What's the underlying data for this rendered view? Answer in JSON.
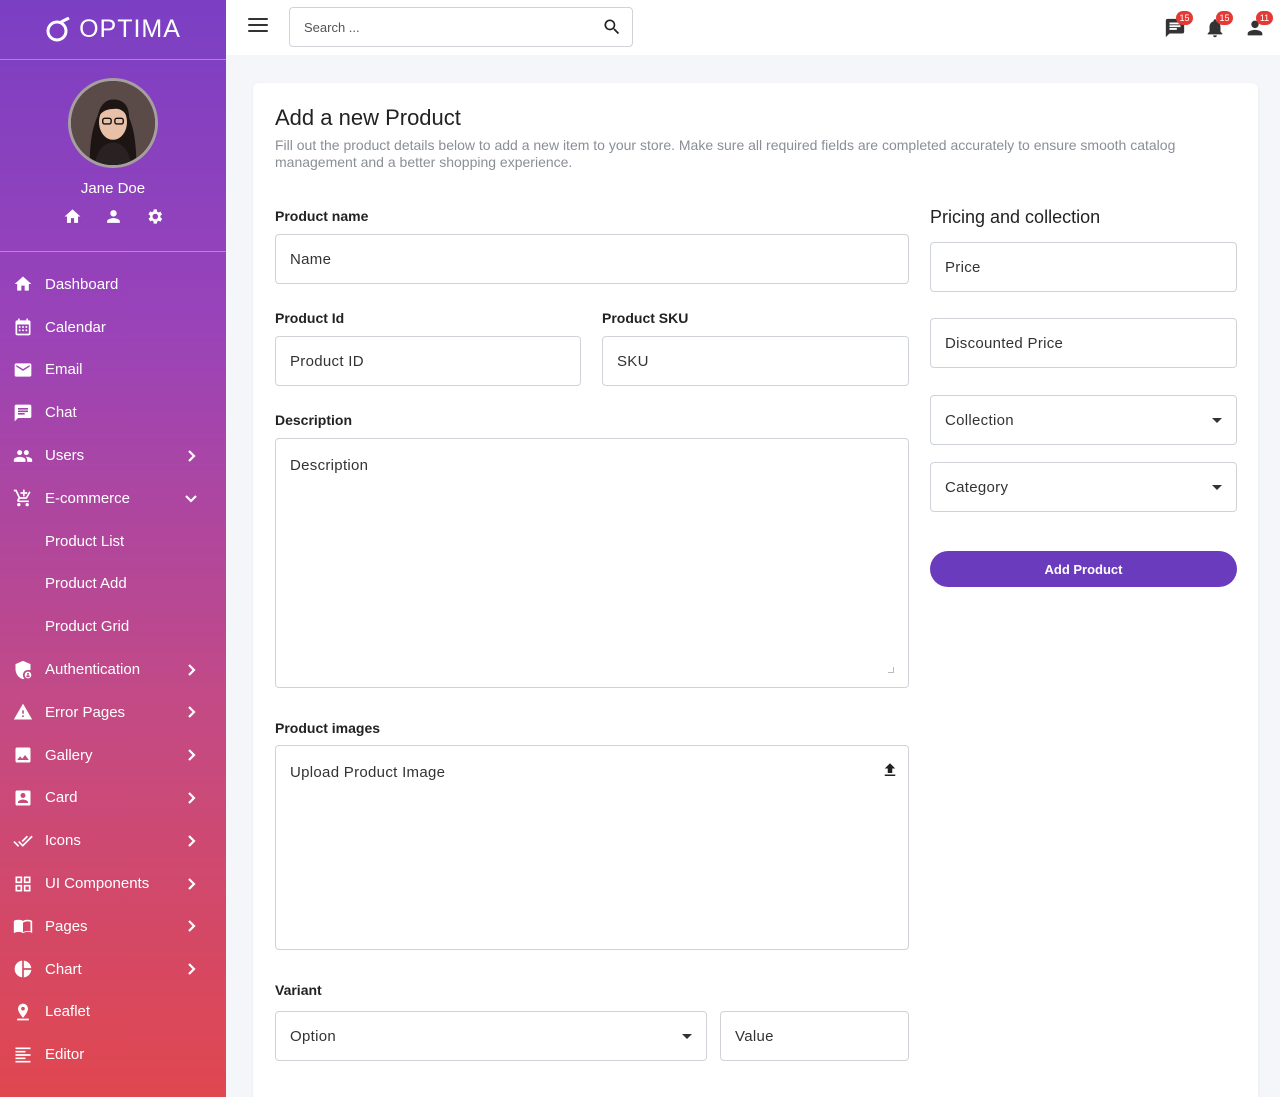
{
  "brand": {
    "name": "OPTIMA"
  },
  "user": {
    "name": "Jane Doe"
  },
  "sidebar": {
    "items": [
      {
        "label": "Dashboard",
        "icon": "home-icon",
        "chevron": ""
      },
      {
        "label": "Calendar",
        "icon": "calendar-icon",
        "chevron": ""
      },
      {
        "label": "Email",
        "icon": "email-icon",
        "chevron": ""
      },
      {
        "label": "Chat",
        "icon": "chat-icon",
        "chevron": ""
      },
      {
        "label": "Users",
        "icon": "users-icon",
        "chevron": "right"
      },
      {
        "label": "E-commerce",
        "icon": "cart-icon",
        "chevron": "down"
      },
      {
        "label": "Product List",
        "sub": true
      },
      {
        "label": "Product Add",
        "sub": true
      },
      {
        "label": "Product Grid",
        "sub": true
      },
      {
        "label": "Authentication",
        "icon": "shield-icon",
        "chevron": "right"
      },
      {
        "label": "Error Pages",
        "icon": "warning-icon",
        "chevron": "right"
      },
      {
        "label": "Gallery",
        "icon": "image-icon",
        "chevron": "right"
      },
      {
        "label": "Card",
        "icon": "contact-card-icon",
        "chevron": "right"
      },
      {
        "label": "Icons",
        "icon": "check-icon",
        "chevron": "right"
      },
      {
        "label": "UI Components",
        "icon": "grid-icon",
        "chevron": "right"
      },
      {
        "label": "Pages",
        "icon": "book-icon",
        "chevron": "right"
      },
      {
        "label": "Chart",
        "icon": "pie-chart-icon",
        "chevron": "right"
      },
      {
        "label": "Leaflet",
        "icon": "map-pin-icon",
        "chevron": ""
      },
      {
        "label": "Editor",
        "icon": "text-editor-icon",
        "chevron": ""
      }
    ]
  },
  "topbar": {
    "search_placeholder": "Search ...",
    "badges": {
      "messages": "15",
      "notifications": "15",
      "account": "11"
    }
  },
  "page": {
    "title": "Add a new Product",
    "description": "Fill out the product details below to add a new item to your store. Make sure all required fields are completed accurately to ensure smooth catalog management and a better shopping experience."
  },
  "form": {
    "product_name_label": "Product name",
    "product_name_placeholder": "Name",
    "product_id_label": "Product Id",
    "product_id_placeholder": "Product ID",
    "sku_label": "Product SKU",
    "sku_placeholder": "SKU",
    "description_label": "Description",
    "description_placeholder": "Description",
    "images_label": "Product images",
    "images_placeholder": "Upload Product Image",
    "variant_label": "Variant",
    "option_placeholder": "Option",
    "value_placeholder": "Value"
  },
  "pricing": {
    "title": "Pricing and collection",
    "price_placeholder": "Price",
    "discounted_placeholder": "Discounted Price",
    "collection_placeholder": "Collection",
    "category_placeholder": "Category",
    "submit_label": "Add Product"
  },
  "colors": {
    "accent": "#6a3bbd",
    "badge": "#e53935",
    "sidebar_top": "#7b3fc4",
    "sidebar_bottom": "#e0474f"
  }
}
